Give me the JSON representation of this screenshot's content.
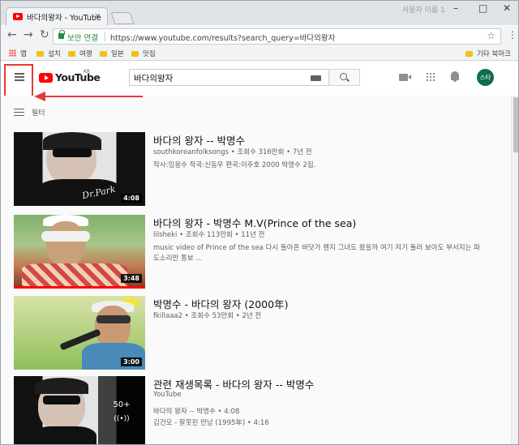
{
  "browser": {
    "tab_title": "바다의왕자 - YouTube",
    "tab_close": "×",
    "user_label": "사용자 이름 1",
    "win_min": "–",
    "win_max": "□",
    "win_close": "✕",
    "back": "←",
    "forward": "→",
    "reload": "↻",
    "secure_label": "보안 연결",
    "url": "https://www.youtube.com/results?search_query=바다의왕자",
    "star": "☆",
    "menu": "⋮"
  },
  "bookmarks": {
    "apps": "앱",
    "items": [
      "설치",
      "여행",
      "일본",
      "맛집"
    ],
    "other": "기타 북마크"
  },
  "youtube": {
    "logo_text": "YouTube",
    "logo_region": "KR",
    "search_value": "바다의왕자",
    "avatar_label": "스타",
    "filter_label": "필터"
  },
  "results": [
    {
      "title": "바다의 왕자 -- 박명수",
      "meta": "southkoreanfolksongs • 조회수 316만회 • 7년 전",
      "desc": "작사:임웅수 작곡:신동우 편곡:이주호 2000 박명수 2집.",
      "duration": "4:08",
      "signature": "Dr.Park"
    },
    {
      "title": "바다의 왕자 - 박명수 M.V(Prince of the sea)",
      "meta": "lilsheki • 조회수 113만회 • 11년 전",
      "desc": "music video of Prince of the sea 다시 돌아온 바닷가 왠지 그녀도 왔을까 여기 저기 둘러 보아도 부서지는 파도소리만 통보 ...",
      "duration": "3:48"
    },
    {
      "title": "박명수 - 바다의 왕자 (2000年)",
      "meta": "fkillaaa2 • 조회수 53만회 • 2년 전",
      "desc": "",
      "duration": "3:00"
    },
    {
      "title": "관련 재생목록 - 바다의 왕자 -- 박명수",
      "meta": "YouTube",
      "line1": "바다의 왕자 -- 박명수 • 4:08",
      "line2": "김건모 - 잘못된 만남 (1995年) • 4:16",
      "count": "50+",
      "icon": "((•))"
    }
  ],
  "colors": {
    "brand": "#ff0000",
    "annotation": "#e53935",
    "secure": "#1e8e3e"
  }
}
